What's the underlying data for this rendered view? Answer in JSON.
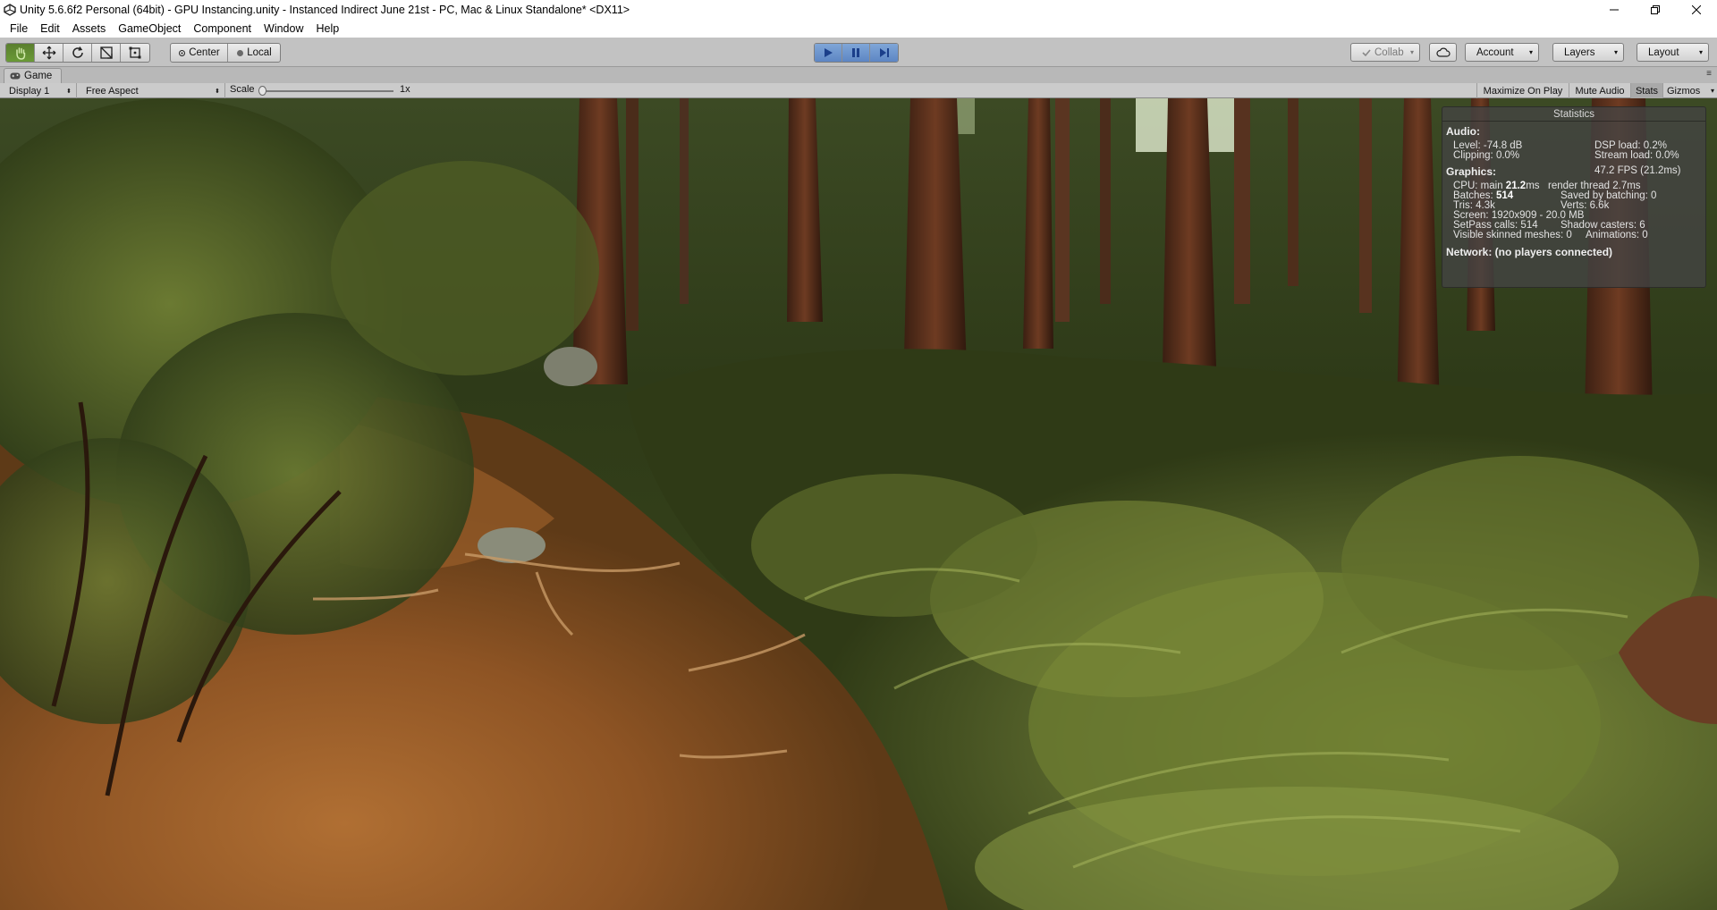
{
  "window": {
    "title": "Unity 5.6.6f2 Personal (64bit) - GPU Instancing.unity - Instanced Indirect June 21st - PC, Mac & Linux Standalone* <DX11>"
  },
  "menu": [
    "File",
    "Edit",
    "Assets",
    "GameObject",
    "Component",
    "Window",
    "Help"
  ],
  "toolbar": {
    "pivot_label": "Center",
    "space_label": "Local",
    "collab_label": "Collab",
    "account_label": "Account",
    "layers_label": "Layers",
    "layout_label": "Layout"
  },
  "game_view": {
    "tab_label": "Game",
    "display_label": "Display 1",
    "aspect_label": "Free Aspect",
    "scale_label": "Scale",
    "scale_value": "1x",
    "scale_level": 0,
    "maximize_label": "Maximize On Play",
    "mute_label": "Mute Audio",
    "stats_label": "Stats",
    "gizmos_label": "Gizmos"
  },
  "statistics": {
    "title": "Statistics",
    "audio_header": "Audio:",
    "level": "Level: -74.8 dB",
    "dsp_load": "DSP load: 0.2%",
    "clipping": "Clipping: 0.0%",
    "stream_load": "Stream load: 0.0%",
    "graphics_header": "Graphics:",
    "fps": "47.2 FPS (21.2ms)",
    "cpu_main_prefix": "CPU: main ",
    "cpu_main_value": "21.2",
    "cpu_main_unit": "ms",
    "render_thread": "render thread 2.7ms",
    "batches_prefix": "Batches: ",
    "batches_value": "514",
    "saved_by_batching": "Saved by batching: 0",
    "tris": "Tris: 4.3k",
    "verts": "Verts: 6.6k",
    "screen": "Screen: 1920x909 - 20.0 MB",
    "setpass": "SetPass calls: 514",
    "shadow_casters": "Shadow casters: 6",
    "skinned_meshes": "Visible skinned meshes: 0",
    "animations": "Animations: 0",
    "network": "Network: (no players connected)"
  },
  "colors": {
    "play_active": "#5d86c4",
    "tool_active": "#6a9a36",
    "stats_bg": "#444444"
  }
}
